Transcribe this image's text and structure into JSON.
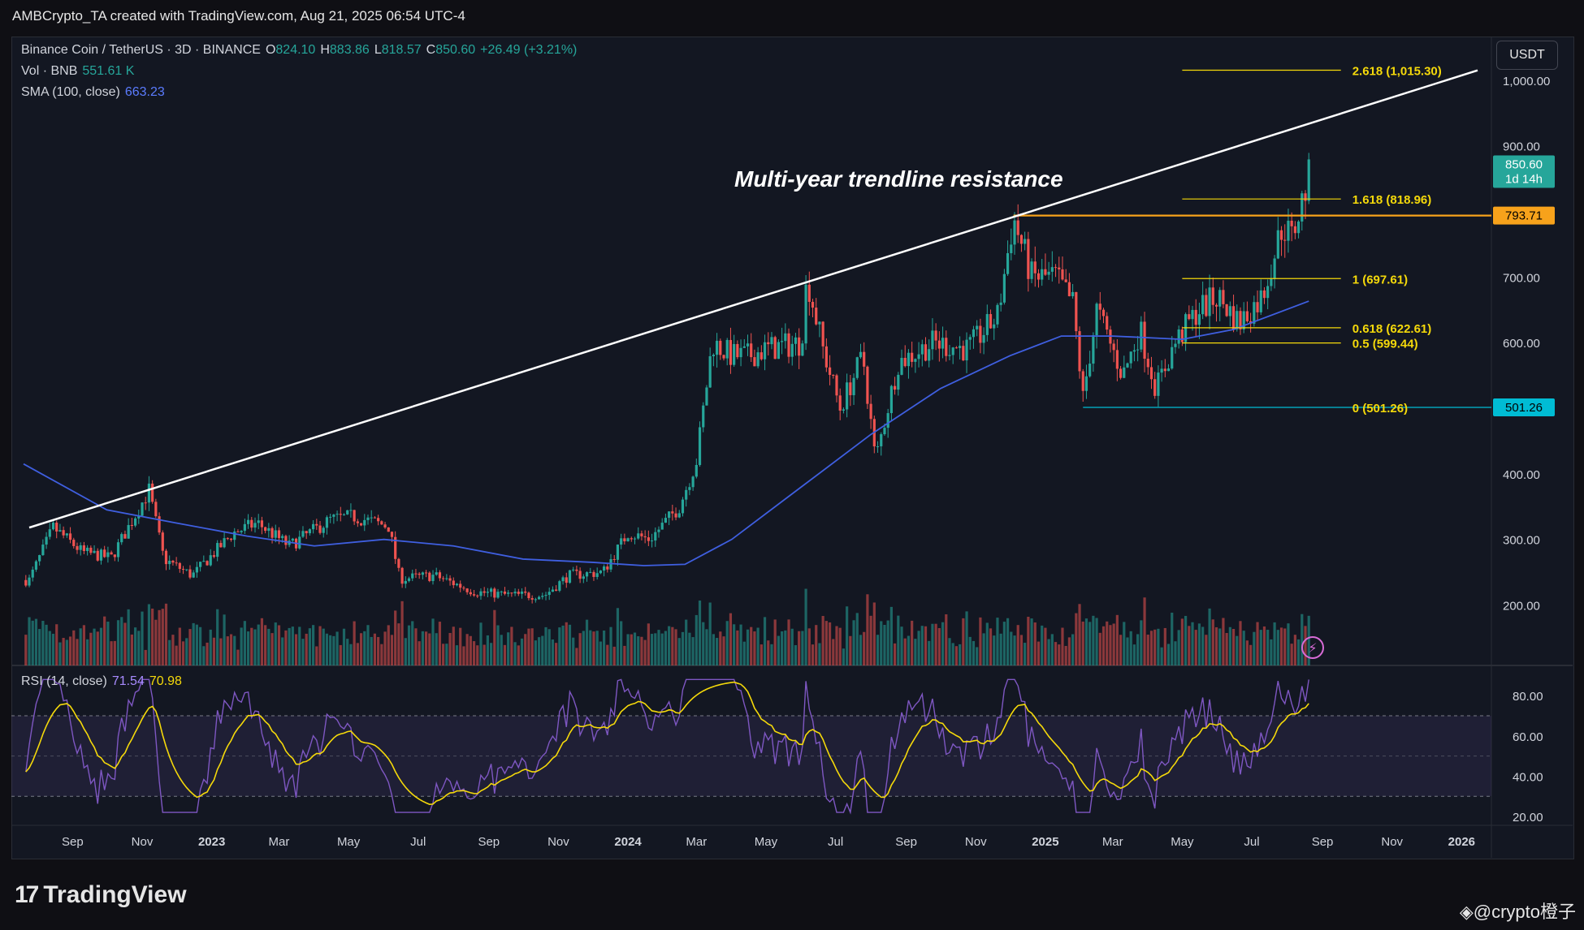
{
  "header": {
    "text": "AMBCrypto_TA created with TradingView.com, Aug 21, 2025 06:54 UTC-4"
  },
  "legend": {
    "symbol": "Binance Coin / TetherUS · 3D · BINANCE",
    "o_label": "O",
    "o_value": "824.10",
    "h_label": "H",
    "h_value": "883.86",
    "l_label": "L",
    "l_value": "818.57",
    "c_label": "C",
    "c_value": "850.60",
    "change": "+26.49 (+3.21%)",
    "vol_label": "Vol · BNB",
    "vol_value": "551.61 K",
    "sma_label": "SMA (100, close)",
    "sma_value": "663.23",
    "rsi_label": "RSI (14, close)",
    "rsi_value": "71.54",
    "rsi_ma_value": "70.98"
  },
  "currency_button": "USDT",
  "annotation": "Multi-year trendline resistance",
  "price_tag": {
    "price": "850.60",
    "countdown": "1d 14h"
  },
  "level_tags": {
    "resistance": "793.71",
    "fib_zero": "501.26"
  },
  "logo": "TradingView",
  "watermark": "◈@crypto橙子",
  "colors": {
    "up": "#26a69a",
    "down": "#ef5350",
    "sma": "#3f5fe0",
    "fib": "#f5d90a",
    "rsi": "#7e57c2",
    "rsi_ma": "#f5d90a",
    "trend": "#ffffff",
    "resistance": "#f7a21b",
    "base": "#00bcd4"
  },
  "chart_data": {
    "type": "candlestick",
    "title": "Binance Coin / TetherUS · 3D · BINANCE",
    "x_ticks": [
      "Sep",
      "Nov",
      "2023",
      "Mar",
      "May",
      "Jul",
      "Sep",
      "Nov",
      "2024",
      "Mar",
      "May",
      "Jul",
      "Sep",
      "Nov",
      "2025",
      "Mar",
      "May",
      "Jul",
      "Sep",
      "Nov",
      "2026"
    ],
    "y_ticks": [
      "1,000.00",
      "900.00",
      "800.00",
      "700.00",
      "600.00",
      "500.00",
      "400.00",
      "300.00",
      "200.00"
    ],
    "ylim": [
      150,
      1030
    ],
    "price_path": [
      [
        "2022-07-25",
        238
      ],
      [
        "2022-08-15",
        318
      ],
      [
        "2022-09-10",
        280
      ],
      [
        "2022-10-05",
        272
      ],
      [
        "2022-11-07",
        375
      ],
      [
        "2022-11-20",
        270
      ],
      [
        "2022-12-15",
        245
      ],
      [
        "2023-01-20",
        310
      ],
      [
        "2023-02-10",
        325
      ],
      [
        "2023-03-10",
        290
      ],
      [
        "2023-04-15",
        330
      ],
      [
        "2023-05-05",
        335
      ],
      [
        "2023-06-05",
        320
      ],
      [
        "2023-06-15",
        240
      ],
      [
        "2023-07-15",
        245
      ],
      [
        "2023-08-20",
        220
      ],
      [
        "2023-09-20",
        215
      ],
      [
        "2023-10-20",
        215
      ],
      [
        "2023-11-10",
        245
      ],
      [
        "2023-12-10",
        250
      ],
      [
        "2024-01-01",
        310
      ],
      [
        "2024-01-20",
        300
      ],
      [
        "2024-02-15",
        350
      ],
      [
        "2024-03-01",
        420
      ],
      [
        "2024-03-15",
        600
      ],
      [
        "2024-04-01",
        580
      ],
      [
        "2024-04-15",
        580
      ],
      [
        "2024-05-01",
        590
      ],
      [
        "2024-06-01",
        600
      ],
      [
        "2024-06-06",
        700
      ],
      [
        "2024-06-20",
        590
      ],
      [
        "2024-07-05",
        500
      ],
      [
        "2024-07-25",
        580
      ],
      [
        "2024-08-05",
        420
      ],
      [
        "2024-08-25",
        570
      ],
      [
        "2024-09-25",
        600
      ],
      [
        "2024-10-25",
        590
      ],
      [
        "2024-11-20",
        640
      ],
      [
        "2024-12-04",
        790
      ],
      [
        "2024-12-20",
        700
      ],
      [
        "2025-01-10",
        700
      ],
      [
        "2025-01-25",
        660
      ],
      [
        "2025-02-03",
        515
      ],
      [
        "2025-02-15",
        650
      ],
      [
        "2025-03-10",
        550
      ],
      [
        "2025-03-25",
        620
      ],
      [
        "2025-04-08",
        530
      ],
      [
        "2025-04-25",
        600
      ],
      [
        "2025-05-15",
        650
      ],
      [
        "2025-06-01",
        670
      ],
      [
        "2025-06-20",
        630
      ],
      [
        "2025-07-10",
        670
      ],
      [
        "2025-07-28",
        780
      ],
      [
        "2025-08-05",
        760
      ],
      [
        "2025-08-20",
        850.6
      ]
    ],
    "sma_100": [
      [
        "2022-07-20",
        415
      ],
      [
        "2022-10-01",
        345
      ],
      [
        "2022-12-01",
        325
      ],
      [
        "2023-02-01",
        305
      ],
      [
        "2023-04-01",
        290
      ],
      [
        "2023-06-01",
        300
      ],
      [
        "2023-08-01",
        290
      ],
      [
        "2023-10-01",
        270
      ],
      [
        "2023-12-01",
        265
      ],
      [
        "2024-01-15",
        260
      ],
      [
        "2024-02-20",
        262
      ],
      [
        "2024-04-01",
        300
      ],
      [
        "2024-06-01",
        380
      ],
      [
        "2024-08-01",
        460
      ],
      [
        "2024-10-01",
        530
      ],
      [
        "2024-12-01",
        580
      ],
      [
        "2025-01-15",
        610
      ],
      [
        "2025-03-01",
        610
      ],
      [
        "2025-05-01",
        605
      ],
      [
        "2025-06-15",
        620
      ],
      [
        "2025-08-20",
        663.23
      ]
    ],
    "trendline": [
      [
        "2022-07-25",
        318
      ],
      [
        "2026-01-15",
        1015
      ]
    ],
    "horizontal_levels": [
      {
        "label": "2.618 (1,015.30)",
        "value": 1015.3
      },
      {
        "label": "1.618 (818.96)",
        "value": 818.96
      },
      {
        "label": "1 (697.61)",
        "value": 697.61
      },
      {
        "label": "0.618 (622.61)",
        "value": 622.61
      },
      {
        "label": "0.5 (599.44)",
        "value": 599.44
      },
      {
        "label": "0 (501.26)",
        "value": 501.26
      },
      {
        "label": "793.71",
        "value": 793.71
      }
    ],
    "rsi": {
      "y_ticks": [
        "80.00",
        "60.00",
        "40.00",
        "20.00"
      ],
      "band": [
        30,
        70
      ],
      "current": 71.54,
      "ma_current": 70.98
    }
  }
}
